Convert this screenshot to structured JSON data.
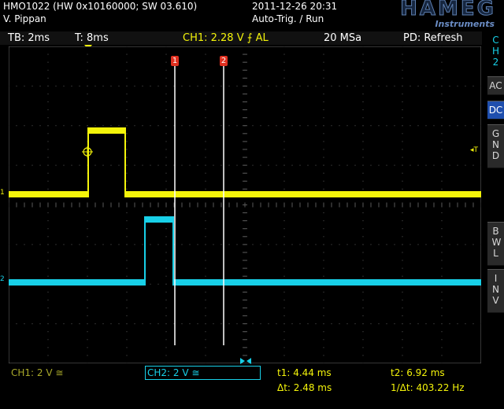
{
  "header": {
    "device": "HMO1022 (HW 0x10160000; SW 03.610)",
    "user": "V. Pippan",
    "datetime": "2011-12-26 20:31",
    "mode": "Auto-Trig. / Run",
    "logo": "HAMEG",
    "logo_sub": "Instruments"
  },
  "status_bar": {
    "timebase": "TB: 2ms",
    "trigger_time": "T: 8ms",
    "trigger_info": "CH1: 2.28 V ",
    "trigger_slope": "⨍",
    "trigger_coupling": " AL",
    "sample_rate": "20 MSa",
    "display_mode": "PD: Refresh"
  },
  "side_panel": {
    "channel": "CH2",
    "ac": "AC",
    "dc": "DC",
    "gnd": "GND",
    "bwl": "BWL",
    "inv": "INV"
  },
  "markers": {
    "cursor1": "1",
    "cursor2": "2",
    "ch1": "1",
    "ch2": "2",
    "trigger_level": "T"
  },
  "bottom": {
    "ch1_scale": "CH1: 2 V ≅",
    "ch2_scale": "CH2: 2 V ≅",
    "t1": "t1: 4.44 ms",
    "t2": "t2: 6.92 ms",
    "dt": "Δt: 2.48 ms",
    "inv_dt": "1/Δt: 403.22 Hz"
  },
  "colors": {
    "ch1": "#f4f40a",
    "ch2": "#18d0e8",
    "grid": "#5a5a5a",
    "cursor_marker": "#e03020",
    "accent_blue": "#1f4fae"
  }
}
